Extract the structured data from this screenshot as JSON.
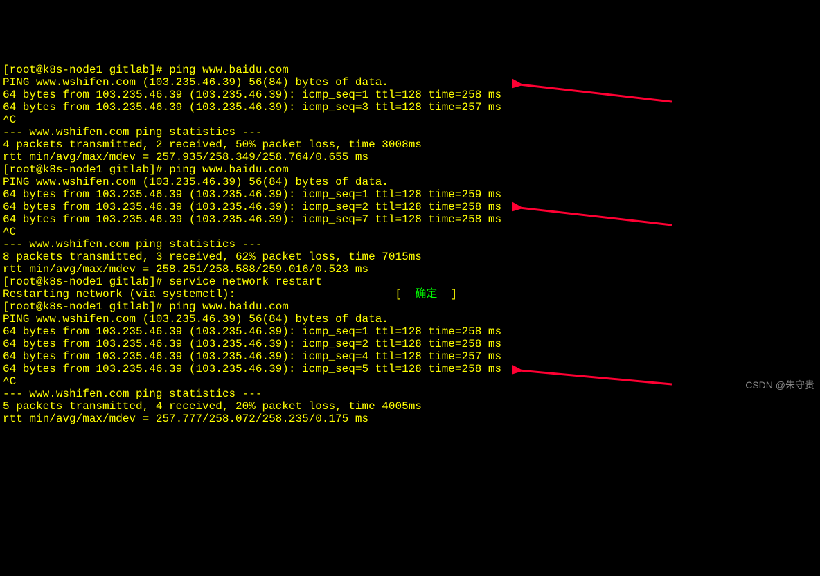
{
  "prompt_user": "root",
  "prompt_host": "k8s-node1",
  "prompt_dir": "gitlab",
  "ping_target": "www.baidu.com",
  "resolved_host": "www.wshifen.com",
  "resolved_ip": "103.235.46.39",
  "icmp_header": "PING www.wshifen.com (103.235.46.39) 56(84) bytes of data.",
  "caret_c": "^C",
  "stats_header": "--- www.wshifen.com ping statistics ---",
  "cmd_ping": "ping www.baidu.com",
  "cmd_restart": "service network restart",
  "restart_msg": "Restarting network (via systemctl):",
  "restart_ok": "确定",
  "block1": {
    "replies": [
      {
        "bytes": "64",
        "from": "103.235.46.39",
        "seq": "1",
        "ttl": "128",
        "time": "258"
      },
      {
        "bytes": "64",
        "from": "103.235.46.39",
        "seq": "3",
        "ttl": "128",
        "time": "257"
      }
    ],
    "summary": "4 packets transmitted, 2 received, 50% packet loss, time 3008ms",
    "rtt": "rtt min/avg/max/mdev = 257.935/258.349/258.764/0.655 ms"
  },
  "block2": {
    "replies": [
      {
        "bytes": "64",
        "from": "103.235.46.39",
        "seq": "1",
        "ttl": "128",
        "time": "259"
      },
      {
        "bytes": "64",
        "from": "103.235.46.39",
        "seq": "2",
        "ttl": "128",
        "time": "258"
      },
      {
        "bytes": "64",
        "from": "103.235.46.39",
        "seq": "7",
        "ttl": "128",
        "time": "258"
      }
    ],
    "summary": "8 packets transmitted, 3 received, 62% packet loss, time 7015ms",
    "rtt": "rtt min/avg/max/mdev = 258.251/258.588/259.016/0.523 ms"
  },
  "block3": {
    "replies": [
      {
        "bytes": "64",
        "from": "103.235.46.39",
        "seq": "1",
        "ttl": "128",
        "time": "258"
      },
      {
        "bytes": "64",
        "from": "103.235.46.39",
        "seq": "2",
        "ttl": "128",
        "time": "258"
      },
      {
        "bytes": "64",
        "from": "103.235.46.39",
        "seq": "4",
        "ttl": "128",
        "time": "257"
      },
      {
        "bytes": "64",
        "from": "103.235.46.39",
        "seq": "5",
        "ttl": "128",
        "time": "258"
      }
    ],
    "summary": "5 packets transmitted, 4 received, 20% packet loss, time 4005ms",
    "rtt": "rtt min/avg/max/mdev = 257.777/258.072/258.235/0.175 ms"
  },
  "watermark": "CSDN @朱守贵"
}
